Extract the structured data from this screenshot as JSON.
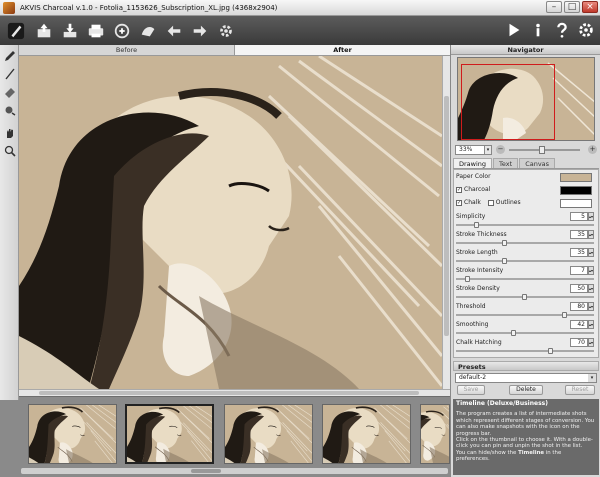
{
  "window": {
    "title": "AKVIS Charcoal v.1.0 - Fotolia_1153626_Subscription_XL.jpg (4368x2904)",
    "minimize": "–",
    "maximize": "□",
    "close": "×"
  },
  "toolbar": {
    "icons": [
      "charcoal-logo-icon",
      "open-icon",
      "save-icon",
      "print-icon",
      "share-icon",
      "batch-icon",
      "undo-icon",
      "redo-icon",
      "settings-gear-icon",
      "run-icon",
      "info-icon",
      "help-icon",
      "preferences-icon"
    ]
  },
  "view_tabs": [
    {
      "label": "Before",
      "active": false
    },
    {
      "label": "After",
      "active": true
    }
  ],
  "navigator": {
    "title": "Navigator",
    "zoom": "33%",
    "zoom_arrow": "▾",
    "minus": "−",
    "plus": "+"
  },
  "settings_tabs": [
    {
      "label": "Drawing",
      "active": true
    },
    {
      "label": "Text",
      "active": false
    },
    {
      "label": "Canvas",
      "active": false
    }
  ],
  "colors": {
    "paper": "#c8b496",
    "charcoal": "#000000",
    "chalk": "#ffffff",
    "accent": "#d01c1c"
  },
  "settings": {
    "paper_color": "Paper Color",
    "charcoal": "Charcoal",
    "chalk": "Chalk",
    "outlines": "Outlines",
    "check": "✓",
    "spin": "▴▾",
    "params": [
      {
        "label": "Simplicity",
        "value": "5",
        "level": 0.14
      },
      {
        "label": "Stroke Thickness",
        "value": "35",
        "level": 0.35
      },
      {
        "label": "Stroke Length",
        "value": "35",
        "level": 0.35
      },
      {
        "label": "Stroke Intensity",
        "value": "7",
        "level": 0.07
      },
      {
        "label": "Stroke Density",
        "value": "50",
        "level": 0.5
      },
      {
        "label": "Threshold",
        "value": "80",
        "level": 0.8
      },
      {
        "label": "Smoothing",
        "value": "42",
        "level": 0.42
      },
      {
        "label": "Chalk Hatching",
        "value": "70",
        "level": 0.7
      }
    ]
  },
  "presets": {
    "title": "Presets",
    "selected": "default-2",
    "dd": "▾",
    "save": "Save",
    "delete": "Delete",
    "reset": "Reset"
  },
  "help": {
    "title": "Timeline (Deluxe/Business)",
    "p1": "The program creates a list of intermediate shots which represent different stages of conversion. You can also make snapshots with the icon on the progress bar.",
    "p2": "Click on the thumbnail to choose it. With a double-click you can pin and unpin the shot in the list.",
    "p3_a": "You can hide/show the ",
    "p3_b": "Timeline",
    "p3_c": " in the preferences."
  }
}
